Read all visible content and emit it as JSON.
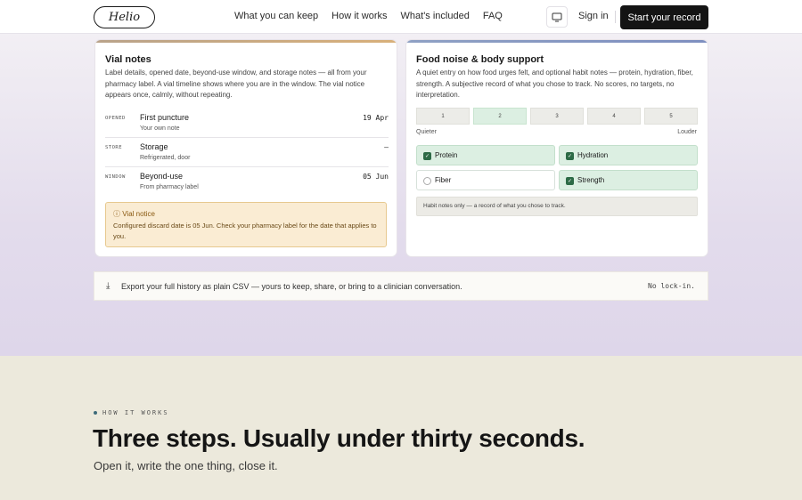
{
  "nav": {
    "logo": "Helio",
    "links": [
      "What you can keep",
      "How it works",
      "What's included",
      "FAQ"
    ],
    "sign_in": "Sign in",
    "cta": "Start your record"
  },
  "vial": {
    "title": "Vial notes",
    "description": "Label details, opened date, beyond-use window, and storage notes — all from your pharmacy label. A vial timeline shows where you are in the window. The vial notice appears once, calmly, without repeating.",
    "rows": [
      {
        "key": "OPENED",
        "title": "First puncture",
        "sub": "Your own note",
        "value": "19 Apr"
      },
      {
        "key": "STORE",
        "title": "Storage",
        "sub": "Refrigerated, door",
        "value": "—"
      },
      {
        "key": "WINDOW",
        "title": "Beyond-use",
        "sub": "From pharmacy label",
        "value": "05 Jun"
      }
    ],
    "notice": {
      "title": "ⓘ Vial notice",
      "body": "Configured discard date is 05 Jun. Check your pharmacy label for the date that applies to you."
    }
  },
  "food": {
    "title": "Food noise & body support",
    "description": "A quiet entry on how food urges felt, and optional habit notes — protein, hydration, fiber, strength. A subjective record of what you chose to track. No scores, no targets, no interpretation.",
    "scale": [
      "1",
      "2",
      "3",
      "4",
      "5"
    ],
    "scale_selected": "2",
    "scale_low": "Quieter",
    "scale_high": "Louder",
    "habits": [
      {
        "label": "Protein",
        "checked": true
      },
      {
        "label": "Hydration",
        "checked": true
      },
      {
        "label": "Fiber",
        "checked": false
      },
      {
        "label": "Strength",
        "checked": true
      }
    ],
    "habit_note": "Habit notes only — a record of what you chose to track."
  },
  "export": {
    "icon": "download-icon",
    "text": "Export your full history as plain CSV — yours to keep, share, or bring to a clinician conversation.",
    "right": "No lock-in."
  },
  "section": {
    "label": "HOW IT WORKS",
    "title": "Three steps. Usually under thirty seconds.",
    "subtitle": "Open it, write the one thing, close it."
  }
}
